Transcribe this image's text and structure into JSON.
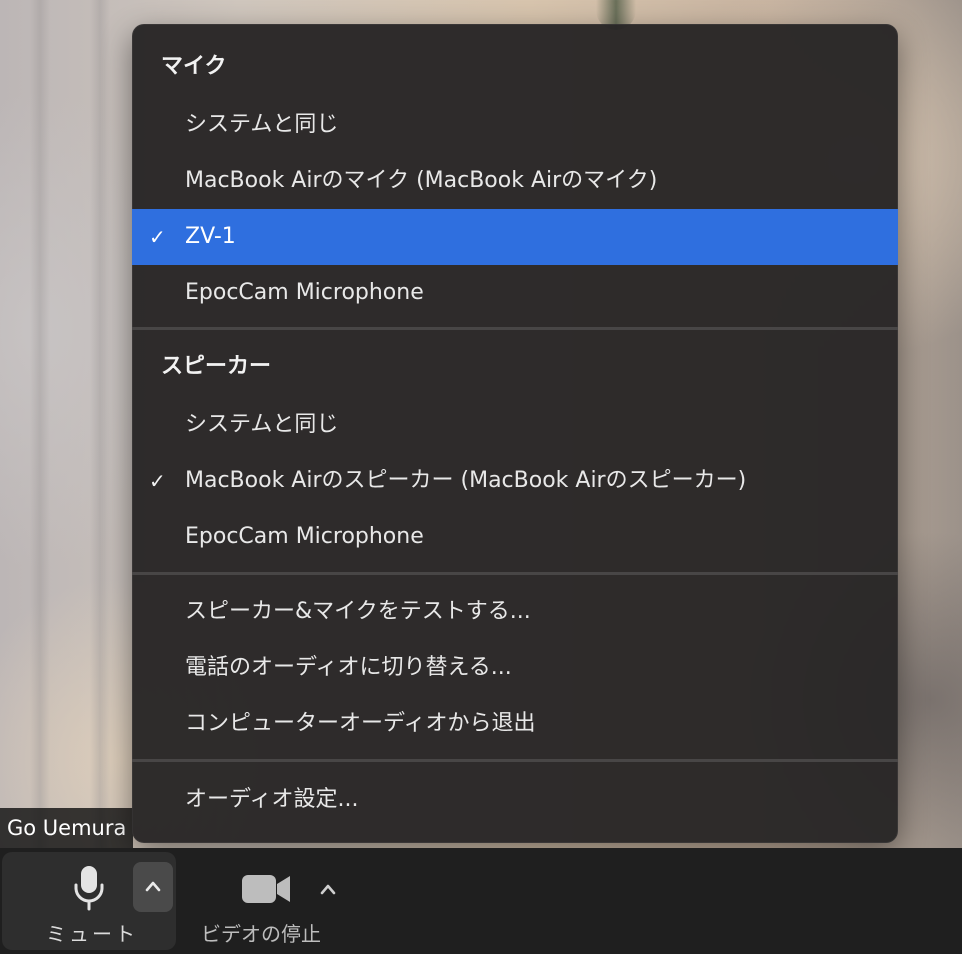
{
  "menu": {
    "mic_header": "マイク",
    "mic_items": [
      {
        "label": "システムと同じ",
        "checked": false
      },
      {
        "label": "MacBook Airのマイク (MacBook Airのマイク)",
        "checked": false
      },
      {
        "label": "ZV-1",
        "checked": true
      },
      {
        "label": "EpocCam Microphone",
        "checked": false
      }
    ],
    "speaker_header": "スピーカー",
    "speaker_items": [
      {
        "label": "システムと同じ",
        "checked": false
      },
      {
        "label": "MacBook Airのスピーカー (MacBook Airのスピーカー)",
        "checked": true
      },
      {
        "label": "EpocCam Microphone",
        "checked": false
      }
    ],
    "actions": [
      "スピーカー&マイクをテストする...",
      "電話のオーディオに切り替える...",
      "コンピューターオーディオから退出"
    ],
    "settings": "オーディオ設定...",
    "check_mark": "✓",
    "selected_color": "#2f6fdf"
  },
  "name_tag": "Go Uemura",
  "toolbar": {
    "mute_label": "ミュート",
    "video_label": "ビデオの停止",
    "mic_icon": "microphone-icon",
    "camera_icon": "video-camera-icon"
  }
}
